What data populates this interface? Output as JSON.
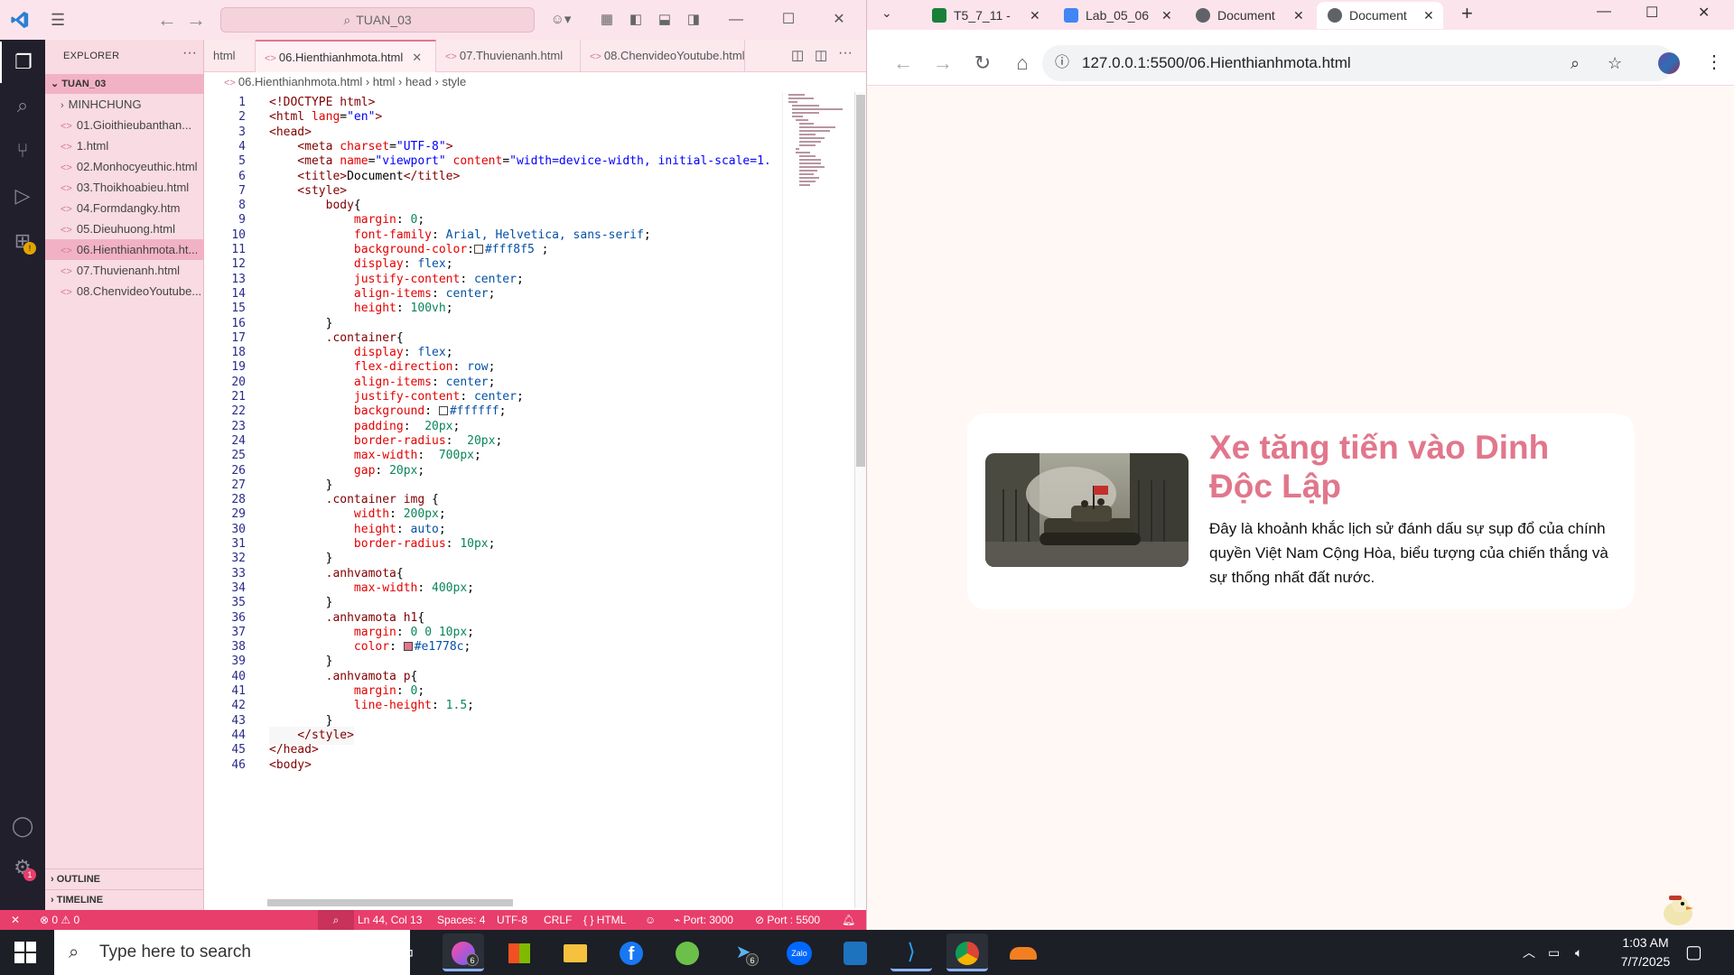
{
  "vscode": {
    "title_search": "TUAN_03",
    "explorer_header": "EXPLORER",
    "workspace": "TUAN_03",
    "folders": [
      {
        "label": "MINHCHUNG"
      }
    ],
    "files": [
      {
        "label": "01.Gioithieubanthan..."
      },
      {
        "label": "1.html"
      },
      {
        "label": "02.Monhocyeuthic.html"
      },
      {
        "label": "03.Thoikhoabieu.html"
      },
      {
        "label": "04.Formdangky.htm"
      },
      {
        "label": "05.Dieuhuong.html"
      },
      {
        "label": "06.Hienthianhmota.ht..."
      },
      {
        "label": "07.Thuvienanh.html"
      },
      {
        "label": "08.ChenvideoYoutube..."
      }
    ],
    "outline": "OUTLINE",
    "timeline": "TIMELINE",
    "tabs": [
      {
        "label": "html"
      },
      {
        "label": "06.Hienthianhmota.html"
      },
      {
        "label": "07.Thuvienanh.html"
      },
      {
        "label": "08.ChenvideoYoutube.html"
      }
    ],
    "breadcrumb": [
      "06.Hienthianhmota.html",
      "html",
      "head",
      "style"
    ],
    "settings_badge": "1",
    "status": {
      "errors": "0",
      "warnings": "0",
      "position": "Ln 44, Col 13",
      "spaces": "Spaces: 4",
      "encoding": "UTF-8",
      "eol": "CRLF",
      "language": "HTML",
      "port1": "Port: 3000",
      "port2": "Port : 5500"
    }
  },
  "code_lines": [
    [
      {
        "t": "<!DOCTYPE ",
        "c": "tag"
      },
      {
        "t": "html",
        "c": "tag"
      },
      {
        "t": ">",
        "c": "tag"
      }
    ],
    [
      {
        "t": "<html ",
        "c": "tag"
      },
      {
        "t": "lang",
        "c": "attr"
      },
      {
        "t": "=",
        "c": "p"
      },
      {
        "t": "\"en\"",
        "c": "str"
      },
      {
        "t": ">",
        "c": "tag"
      }
    ],
    [
      {
        "t": "<head>",
        "c": "tag"
      }
    ],
    [
      {
        "t": "    <meta ",
        "c": "tag"
      },
      {
        "t": "charset",
        "c": "attr"
      },
      {
        "t": "=",
        "c": "p"
      },
      {
        "t": "\"UTF-8\"",
        "c": "str"
      },
      {
        "t": ">",
        "c": "tag"
      }
    ],
    [
      {
        "t": "    <meta ",
        "c": "tag"
      },
      {
        "t": "name",
        "c": "attr"
      },
      {
        "t": "=",
        "c": "p"
      },
      {
        "t": "\"viewport\" ",
        "c": "str"
      },
      {
        "t": "content",
        "c": "attr"
      },
      {
        "t": "=",
        "c": "p"
      },
      {
        "t": "\"width=device-width, initial-scale=1.",
        "c": "str"
      }
    ],
    [
      {
        "t": "    <title>",
        "c": "tag"
      },
      {
        "t": "Document",
        "c": "p"
      },
      {
        "t": "</title>",
        "c": "tag"
      }
    ],
    [
      {
        "t": "    <style>",
        "c": "tag"
      }
    ],
    [
      {
        "t": "        body",
        "c": "sel"
      },
      {
        "t": "{",
        "c": "p"
      }
    ],
    [
      {
        "t": "            margin",
        "c": "prop"
      },
      {
        "t": ": ",
        "c": "p"
      },
      {
        "t": "0",
        "c": "num"
      },
      {
        "t": ";",
        "c": "p"
      }
    ],
    [
      {
        "t": "            font-family",
        "c": "prop"
      },
      {
        "t": ": ",
        "c": "p"
      },
      {
        "t": "Arial, Helvetica, sans-serif",
        "c": "val"
      },
      {
        "t": ";",
        "c": "p"
      }
    ],
    [
      {
        "t": "            background-color",
        "c": "prop"
      },
      {
        "t": ":",
        "c": "p"
      },
      {
        "t": "",
        "c": "sw",
        "color": "#fff8f5"
      },
      {
        "t": "#fff8f5",
        "c": "val"
      },
      {
        "t": " ;",
        "c": "p"
      }
    ],
    [
      {
        "t": "            display",
        "c": "prop"
      },
      {
        "t": ": ",
        "c": "p"
      },
      {
        "t": "flex",
        "c": "val"
      },
      {
        "t": ";",
        "c": "p"
      }
    ],
    [
      {
        "t": "            justify-content",
        "c": "prop"
      },
      {
        "t": ": ",
        "c": "p"
      },
      {
        "t": "center",
        "c": "val"
      },
      {
        "t": ";",
        "c": "p"
      }
    ],
    [
      {
        "t": "            align-items",
        "c": "prop"
      },
      {
        "t": ": ",
        "c": "p"
      },
      {
        "t": "center",
        "c": "val"
      },
      {
        "t": ";",
        "c": "p"
      }
    ],
    [
      {
        "t": "            height",
        "c": "prop"
      },
      {
        "t": ": ",
        "c": "p"
      },
      {
        "t": "100vh",
        "c": "num"
      },
      {
        "t": ";",
        "c": "p"
      }
    ],
    [
      {
        "t": "        }",
        "c": "p"
      }
    ],
    [
      {
        "t": "        .container",
        "c": "sel"
      },
      {
        "t": "{",
        "c": "p"
      }
    ],
    [
      {
        "t": "            display",
        "c": "prop"
      },
      {
        "t": ": ",
        "c": "p"
      },
      {
        "t": "flex",
        "c": "val"
      },
      {
        "t": ";",
        "c": "p"
      }
    ],
    [
      {
        "t": "            flex-direction",
        "c": "prop"
      },
      {
        "t": ": ",
        "c": "p"
      },
      {
        "t": "row",
        "c": "val"
      },
      {
        "t": ";",
        "c": "p"
      }
    ],
    [
      {
        "t": "            align-items",
        "c": "prop"
      },
      {
        "t": ": ",
        "c": "p"
      },
      {
        "t": "center",
        "c": "val"
      },
      {
        "t": ";",
        "c": "p"
      }
    ],
    [
      {
        "t": "            justify-content",
        "c": "prop"
      },
      {
        "t": ": ",
        "c": "p"
      },
      {
        "t": "center",
        "c": "val"
      },
      {
        "t": ";",
        "c": "p"
      }
    ],
    [
      {
        "t": "            background",
        "c": "prop"
      },
      {
        "t": ": ",
        "c": "p"
      },
      {
        "t": "",
        "c": "sw",
        "color": "#ffffff"
      },
      {
        "t": "#ffffff",
        "c": "val"
      },
      {
        "t": ";",
        "c": "p"
      }
    ],
    [
      {
        "t": "            padding",
        "c": "prop"
      },
      {
        "t": ":  ",
        "c": "p"
      },
      {
        "t": "20px",
        "c": "num"
      },
      {
        "t": ";",
        "c": "p"
      }
    ],
    [
      {
        "t": "            border-radius",
        "c": "prop"
      },
      {
        "t": ":  ",
        "c": "p"
      },
      {
        "t": "20px",
        "c": "num"
      },
      {
        "t": ";",
        "c": "p"
      }
    ],
    [
      {
        "t": "            max-width",
        "c": "prop"
      },
      {
        "t": ":  ",
        "c": "p"
      },
      {
        "t": "700px",
        "c": "num"
      },
      {
        "t": ";",
        "c": "p"
      }
    ],
    [
      {
        "t": "            gap",
        "c": "prop"
      },
      {
        "t": ": ",
        "c": "p"
      },
      {
        "t": "20px",
        "c": "num"
      },
      {
        "t": ";",
        "c": "p"
      }
    ],
    [
      {
        "t": "        }",
        "c": "p"
      }
    ],
    [
      {
        "t": "        .container img ",
        "c": "sel"
      },
      {
        "t": "{",
        "c": "p"
      }
    ],
    [
      {
        "t": "            width",
        "c": "prop"
      },
      {
        "t": ": ",
        "c": "p"
      },
      {
        "t": "200px",
        "c": "num"
      },
      {
        "t": ";",
        "c": "p"
      }
    ],
    [
      {
        "t": "            height",
        "c": "prop"
      },
      {
        "t": ": ",
        "c": "p"
      },
      {
        "t": "auto",
        "c": "val"
      },
      {
        "t": ";",
        "c": "p"
      }
    ],
    [
      {
        "t": "            border-radius",
        "c": "prop"
      },
      {
        "t": ": ",
        "c": "p"
      },
      {
        "t": "10px",
        "c": "num"
      },
      {
        "t": ";",
        "c": "p"
      }
    ],
    [
      {
        "t": "        }",
        "c": "p"
      }
    ],
    [
      {
        "t": "        .anhvamota",
        "c": "sel"
      },
      {
        "t": "{",
        "c": "p"
      }
    ],
    [
      {
        "t": "            max-width",
        "c": "prop"
      },
      {
        "t": ": ",
        "c": "p"
      },
      {
        "t": "400px",
        "c": "num"
      },
      {
        "t": ";",
        "c": "p"
      }
    ],
    [
      {
        "t": "        }",
        "c": "p"
      }
    ],
    [
      {
        "t": "        .anhvamota h1",
        "c": "sel"
      },
      {
        "t": "{",
        "c": "p"
      }
    ],
    [
      {
        "t": "            margin",
        "c": "prop"
      },
      {
        "t": ": ",
        "c": "p"
      },
      {
        "t": "0 0 10px",
        "c": "num"
      },
      {
        "t": ";",
        "c": "p"
      }
    ],
    [
      {
        "t": "            color",
        "c": "prop"
      },
      {
        "t": ": ",
        "c": "p"
      },
      {
        "t": "",
        "c": "sw",
        "color": "#e1778c"
      },
      {
        "t": "#e1778c",
        "c": "val"
      },
      {
        "t": ";",
        "c": "p"
      }
    ],
    [
      {
        "t": "        }",
        "c": "p"
      }
    ],
    [
      {
        "t": "        .anhvamota p",
        "c": "sel"
      },
      {
        "t": "{",
        "c": "p"
      }
    ],
    [
      {
        "t": "            margin",
        "c": "prop"
      },
      {
        "t": ": ",
        "c": "p"
      },
      {
        "t": "0",
        "c": "num"
      },
      {
        "t": ";",
        "c": "p"
      }
    ],
    [
      {
        "t": "            line-height",
        "c": "prop"
      },
      {
        "t": ": ",
        "c": "p"
      },
      {
        "t": "1.5",
        "c": "num"
      },
      {
        "t": ";",
        "c": "p"
      }
    ],
    [
      {
        "t": "        }",
        "c": "p"
      }
    ],
    [
      {
        "t": "    </style>",
        "c": "tag"
      }
    ],
    [
      {
        "t": "</head>",
        "c": "tag"
      }
    ],
    [
      {
        "t": "<body>",
        "c": "tag"
      }
    ]
  ],
  "chrome": {
    "tabs": [
      {
        "label": "T5_7_11 - ",
        "favicon_color": "#188038"
      },
      {
        "label": "Lab_05_06",
        "favicon_color": "#4285f4"
      },
      {
        "label": "Document",
        "favicon_color": "#5f6368"
      },
      {
        "label": "Document",
        "favicon_color": "#5f6368"
      }
    ],
    "url": "127.0.0.1:5500/06.Hienthianhmota.html",
    "page": {
      "title": "Xe tăng tiến vào Dinh Độc Lập",
      "text": "Đây là khoảnh khắc lịch sử đánh dấu sự sụp đổ của chính quyền Việt Nam Cộng Hòa, biểu tượng của chiến thắng và sự thống nhất đất nước."
    }
  },
  "taskbar": {
    "search_placeholder": "Type here to search",
    "time": "1:03 AM",
    "date": "7/7/2025",
    "badges": {
      "app1": "6",
      "telegram": "6"
    }
  },
  "colors": {
    "accent": "#e1778c",
    "status_bar": "#e83e6c",
    "page_bg": "#fff8f5"
  }
}
